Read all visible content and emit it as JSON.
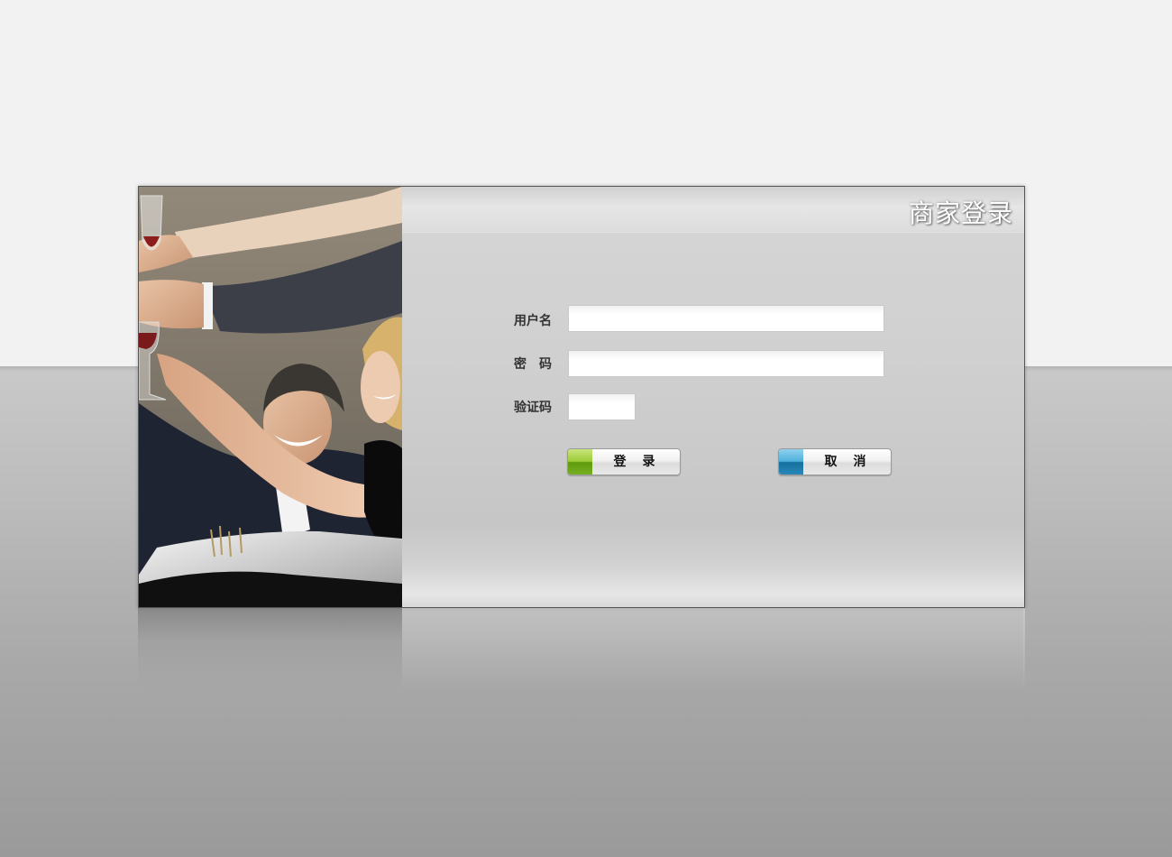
{
  "panel": {
    "title": "商家登录"
  },
  "form": {
    "username_label": "用户名",
    "password_label": "密　码",
    "captcha_label": "验证码",
    "username_value": "",
    "password_value": "",
    "captcha_value": ""
  },
  "buttons": {
    "login_label": "登录",
    "cancel_label": "取消"
  },
  "colors": {
    "login_accent": "#7cb526",
    "cancel_accent": "#2a88b8",
    "title_text": "#ffffff"
  }
}
